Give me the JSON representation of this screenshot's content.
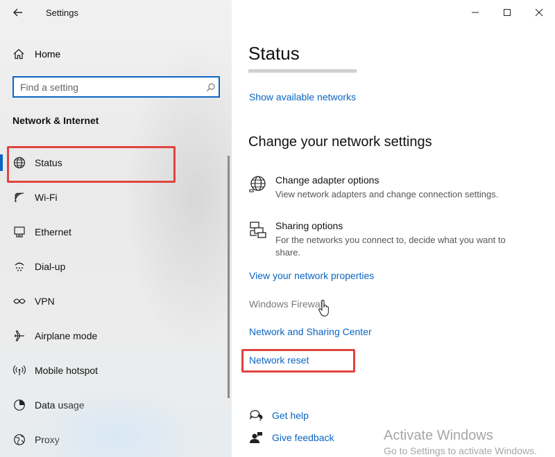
{
  "window": {
    "title": "Settings"
  },
  "sidebar": {
    "home_label": "Home",
    "search_placeholder": "Find a setting",
    "section_title": "Network & Internet",
    "items": [
      {
        "label": "Status",
        "icon": "globe-icon",
        "selected": true
      },
      {
        "label": "Wi-Fi",
        "icon": "wifi-icon"
      },
      {
        "label": "Ethernet",
        "icon": "ethernet-icon"
      },
      {
        "label": "Dial-up",
        "icon": "dialup-icon"
      },
      {
        "label": "VPN",
        "icon": "vpn-icon"
      },
      {
        "label": "Airplane mode",
        "icon": "airplane-icon"
      },
      {
        "label": "Mobile hotspot",
        "icon": "hotspot-icon"
      },
      {
        "label": "Data usage",
        "icon": "data-usage-icon"
      },
      {
        "label": "Proxy",
        "icon": "proxy-icon"
      }
    ]
  },
  "main": {
    "page_title": "Status",
    "show_networks_link": "Show available networks",
    "change_heading": "Change your network settings",
    "options": [
      {
        "title": "Change adapter options",
        "description": "View network adapters and change connection settings.",
        "icon": "adapter-globe-icon"
      },
      {
        "title": "Sharing options",
        "description": "For the networks you connect to, decide what you want to share.",
        "icon": "sharing-icon"
      }
    ],
    "links": {
      "network_properties": "View your network properties",
      "windows_firewall": "Windows Firewall",
      "sharing_center": "Network and Sharing Center",
      "network_reset": "Network reset"
    },
    "help": {
      "get_help": "Get help",
      "give_feedback": "Give feedback"
    }
  },
  "watermark": {
    "line1": "Activate Windows",
    "line2": "Go to Settings to activate Windows."
  },
  "colors": {
    "accent": "#0a64c2",
    "highlight": "#e0433f"
  }
}
